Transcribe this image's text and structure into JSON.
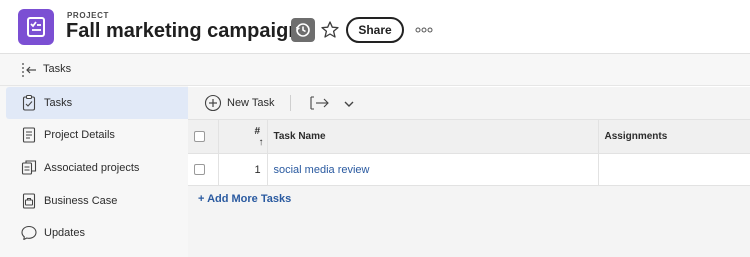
{
  "header": {
    "label": "PROJECT",
    "title": "Fall marketing campaign",
    "share_label": "Share",
    "accent_color": "#7b4fd3"
  },
  "sidebar": {
    "back_label": "Tasks",
    "items": [
      {
        "label": "Tasks",
        "icon": "clipboard-check-icon",
        "active": true
      },
      {
        "label": "Project Details",
        "icon": "document-icon",
        "active": false
      },
      {
        "label": "Associated projects",
        "icon": "linked-projects-icon",
        "active": false
      },
      {
        "label": "Business Case",
        "icon": "briefcase-document-icon",
        "active": false
      },
      {
        "label": "Updates",
        "icon": "chat-bubble-icon",
        "active": false
      }
    ]
  },
  "toolbar": {
    "new_task_label": "New Task"
  },
  "table": {
    "columns": [
      "",
      "#",
      "Task Name",
      "Assignments"
    ],
    "sort_indicator": "↑",
    "rows": [
      {
        "num": "1",
        "name": "social media review",
        "assignments": ""
      }
    ],
    "add_more_label": "+ Add More Tasks"
  }
}
